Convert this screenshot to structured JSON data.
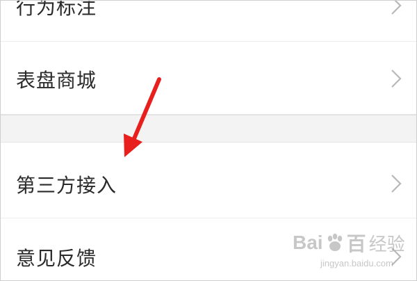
{
  "menu": {
    "items": [
      {
        "label": "行为标注"
      },
      {
        "label": "表盘商城"
      },
      {
        "label": "第三方接入"
      },
      {
        "label": "意见反馈"
      }
    ]
  },
  "annotation": {
    "arrow_color": "#e8201d"
  },
  "watermark": {
    "brand_left": "Bai",
    "brand_right": "百",
    "brand_suffix": "经验",
    "url": "jingyan.baidu.com"
  },
  "colors": {
    "text": "#2a2a2a",
    "chevron": "#b8b8b8",
    "divider": "#ececec",
    "section_gap": "#f3f3f3"
  }
}
